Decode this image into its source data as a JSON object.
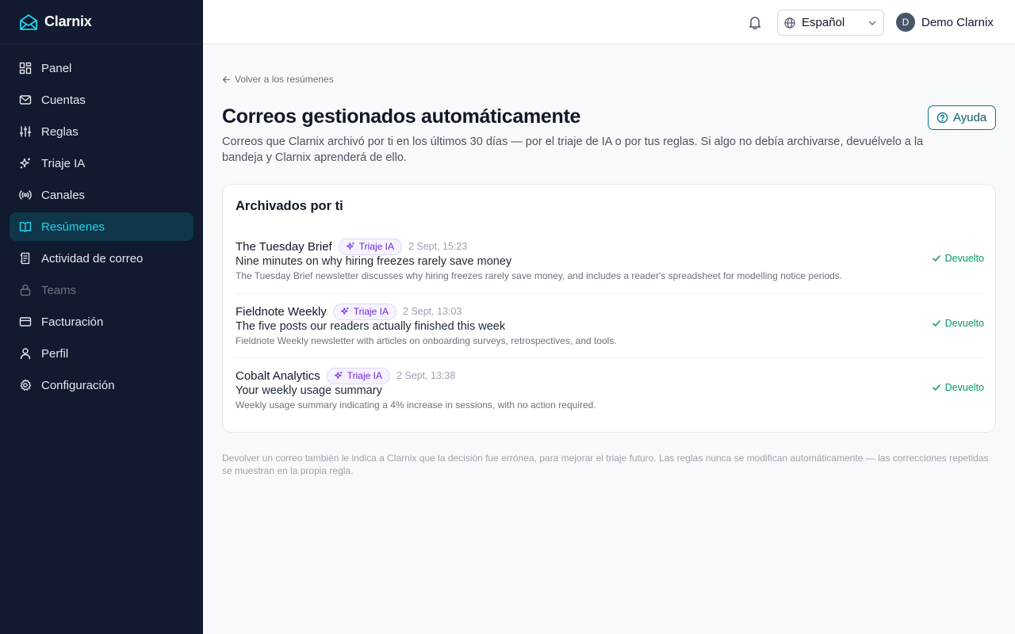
{
  "brand": {
    "name": "Clarnix",
    "accent": "#22d3ee"
  },
  "sidebar": {
    "items": [
      {
        "label": "Panel",
        "icon": "grid-icon"
      },
      {
        "label": "Cuentas",
        "icon": "mail-icon"
      },
      {
        "label": "Reglas",
        "icon": "sliders-icon"
      },
      {
        "label": "Triaje IA",
        "icon": "sparkles-icon"
      },
      {
        "label": "Canales",
        "icon": "broadcast-icon"
      },
      {
        "label": "Resúmenes",
        "icon": "book-open-icon",
        "active": true
      },
      {
        "label": "Actividad de correo",
        "icon": "activity-list-icon"
      },
      {
        "label": "Teams",
        "icon": "lock-icon",
        "disabled": true
      },
      {
        "label": "Facturación",
        "icon": "credit-card-icon"
      },
      {
        "label": "Perfil",
        "icon": "user-icon"
      },
      {
        "label": "Configuración",
        "icon": "gear-icon"
      }
    ]
  },
  "topbar": {
    "language": "Español",
    "user_initial": "D",
    "user_name": "Demo Clarnix"
  },
  "main": {
    "back_label": "Volver a los resúmenes",
    "title": "Correos gestionados automáticamente",
    "help_label": "Ayuda",
    "description": "Correos que Clarnix archivó por ti en los últimos 30 días — por el triaje de IA o por tus reglas. Si algo no debía archivarse, devuélvelo a la bandeja y Clarnix aprenderá de ello.",
    "card": {
      "title": "Archivados por ti",
      "rows": [
        {
          "sender": "The Tuesday Brief",
          "badge": "Triaje IA",
          "date": "2 Sept, 15:23",
          "subject": "Nine minutes on why hiring freezes rarely save money",
          "summary": "The Tuesday Brief newsletter discusses why hiring freezes rarely save money, and includes a reader's spreadsheet for modelling notice periods.",
          "status": "Devuelto"
        },
        {
          "sender": "Fieldnote Weekly",
          "badge": "Triaje IA",
          "date": "2 Sept, 13:03",
          "subject": "The five posts our readers actually finished this week",
          "summary": "Fieldnote Weekly newsletter with articles on onboarding surveys, retrospectives, and tools.",
          "status": "Devuelto"
        },
        {
          "sender": "Cobalt Analytics",
          "badge": "Triaje IA",
          "date": "2 Sept, 13:38",
          "subject": "Your weekly usage summary",
          "summary": "Weekly usage summary indicating a 4% increase in sessions, with no action required.",
          "status": "Devuelto"
        }
      ]
    },
    "footnote": "Devolver un correo también le indica a Clarnix que la decisión fue errónea, para mejorar el triaje futuro. Las reglas nunca se modifican automáticamente — las correcciones repetidas se muestran en la propia regla."
  }
}
